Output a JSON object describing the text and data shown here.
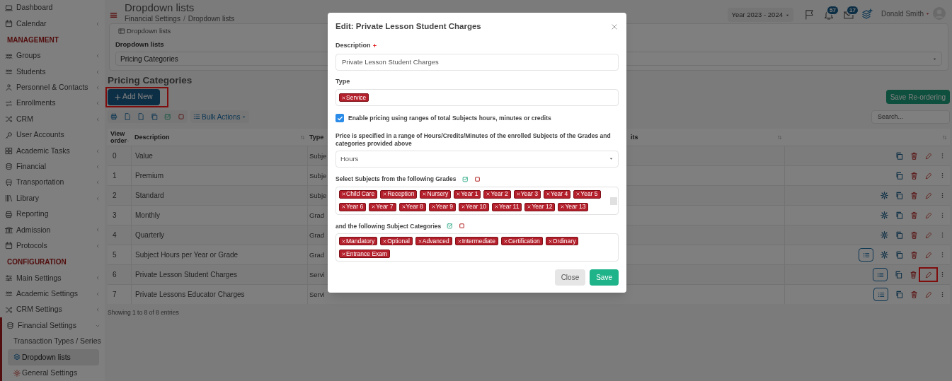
{
  "topbar": {
    "title": "Dropdown lists",
    "breadcrumb": [
      "Financial Settings",
      "Dropdown lists"
    ],
    "breadcrumb_separator": "/",
    "year": "Year 2023 - 2024",
    "notifications": "57",
    "messages": "17",
    "user": "Donald Smith"
  },
  "sidebar": {
    "items": [
      {
        "kind": "link",
        "label": "Dashboard",
        "submenu": false,
        "selected": false
      },
      {
        "kind": "link",
        "label": "Calendar",
        "submenu": true,
        "expanded": false,
        "selected": false
      },
      {
        "kind": "heading",
        "label": "MANAGEMENT"
      },
      {
        "kind": "link",
        "label": "Groups",
        "submenu": true,
        "expanded": false,
        "selected": false
      },
      {
        "kind": "link",
        "label": "Students",
        "submenu": true,
        "expanded": false,
        "selected": false
      },
      {
        "kind": "link",
        "label": "Personnel & Contacts",
        "submenu": true,
        "expanded": false,
        "selected": false
      },
      {
        "kind": "link",
        "label": "Enrollments",
        "submenu": true,
        "expanded": false,
        "selected": false
      },
      {
        "kind": "link",
        "label": "CRM",
        "submenu": true,
        "expanded": false,
        "selected": false
      },
      {
        "kind": "link",
        "label": "User Accounts",
        "submenu": false,
        "selected": false
      },
      {
        "kind": "link",
        "label": "Academic Tasks",
        "submenu": true,
        "expanded": false,
        "selected": false
      },
      {
        "kind": "link",
        "label": "Financial",
        "submenu": true,
        "expanded": false,
        "selected": false
      },
      {
        "kind": "link",
        "label": "Transportation",
        "submenu": true,
        "expanded": false,
        "selected": false
      },
      {
        "kind": "link",
        "label": "Library",
        "submenu": true,
        "expanded": false,
        "selected": false
      },
      {
        "kind": "link",
        "label": "Reporting",
        "submenu": false,
        "selected": false
      },
      {
        "kind": "link",
        "label": "Admission",
        "submenu": true,
        "expanded": false,
        "selected": false
      },
      {
        "kind": "link",
        "label": "Protocols",
        "submenu": true,
        "expanded": false,
        "selected": false
      },
      {
        "kind": "heading",
        "label": "CONFIGURATION"
      },
      {
        "kind": "link",
        "label": "Main Settings",
        "submenu": true,
        "expanded": false,
        "selected": false
      },
      {
        "kind": "link",
        "label": "Academic Settings",
        "submenu": true,
        "expanded": false,
        "selected": false
      },
      {
        "kind": "link",
        "label": "CRM Settings",
        "submenu": true,
        "expanded": false,
        "selected": false
      },
      {
        "kind": "link",
        "label": "Financial Settings",
        "submenu": true,
        "expanded": true,
        "selected": false,
        "children": [
          {
            "label": "Transaction Types / Series",
            "selected": false
          },
          {
            "label": "Dropdown lists",
            "selected": true
          },
          {
            "label": "General Settings",
            "selected": false
          }
        ]
      }
    ]
  },
  "card": {
    "tab": "Dropdown lists",
    "label": "Dropdown lists",
    "value": "Pricing Categories"
  },
  "section_title": "Pricing Categories",
  "add_button": {
    "label": "Add New",
    "highlighted": true
  },
  "save_reorder": "Save Re-ordering",
  "bulk_actions": "Bulk Actions",
  "search": {
    "placeholder": "Search..."
  },
  "table": {
    "columns": [
      "View order",
      "Description",
      "Type",
      "its"
    ],
    "rows": [
      {
        "order": "0",
        "description": "Value",
        "type": "Subje",
        "list_button": false,
        "settings_icon": false,
        "edit_highlighted": false
      },
      {
        "order": "1",
        "description": "Premium",
        "type": "Subje",
        "list_button": false,
        "settings_icon": false,
        "edit_highlighted": false
      },
      {
        "order": "2",
        "description": "Standard",
        "type": "Subje",
        "list_button": false,
        "settings_icon": true,
        "edit_highlighted": false
      },
      {
        "order": "3",
        "description": "Monthly",
        "type": "Grad",
        "list_button": false,
        "settings_icon": true,
        "edit_highlighted": false
      },
      {
        "order": "4",
        "description": "Quarterly",
        "type": "Grad",
        "list_button": false,
        "settings_icon": true,
        "edit_highlighted": false
      },
      {
        "order": "5",
        "description": "Subject Hours per Year or Grade",
        "type": "Grad",
        "list_button": true,
        "settings_icon": true,
        "edit_highlighted": false
      },
      {
        "order": "6",
        "description": "Private Lesson Student Charges",
        "type": "Servi",
        "list_button": true,
        "settings_icon": false,
        "edit_highlighted": true
      },
      {
        "order": "7",
        "description": "Private Lessons Educator Charges",
        "type": "Servi",
        "list_button": true,
        "settings_icon": false,
        "edit_highlighted": false
      }
    ],
    "footer": "Showing 1 to 8 of 8 entries"
  },
  "modal": {
    "title": "Edit: Private Lesson Student Charges",
    "description": {
      "label": "Description",
      "required": true,
      "value": "Private Lesson Student Charges"
    },
    "type": {
      "label": "Type",
      "tags": [
        "Service"
      ]
    },
    "range_pricing": {
      "label": "Enable pricing using ranges of total Subjects hours, minutes or credits",
      "checked": true
    },
    "price_unit": {
      "label": "Price is specified in a range of Hours/Credits/Minutes of the enrolled Subjects of the Grades and categories provided above",
      "value": "Hours"
    },
    "grades": {
      "label": "Select Subjects from the following Grades",
      "tags": [
        "Child Care",
        "Reception",
        "Nursery",
        "Year 1",
        "Year 2",
        "Year 3",
        "Year 4",
        "Year 5",
        "Year 6",
        "Year 7",
        "Year 8",
        "Year 9",
        "Year 10",
        "Year 11",
        "Year 12",
        "Year 13"
      ]
    },
    "categories": {
      "label": "and the following Subject Categories",
      "tags": [
        "Mandatory",
        "Optional",
        "Advanced",
        "Intermediate",
        "Certification",
        "Ordinary",
        "Entrance Exam"
      ]
    },
    "buttons": {
      "close": "Close",
      "save": "Save"
    }
  }
}
